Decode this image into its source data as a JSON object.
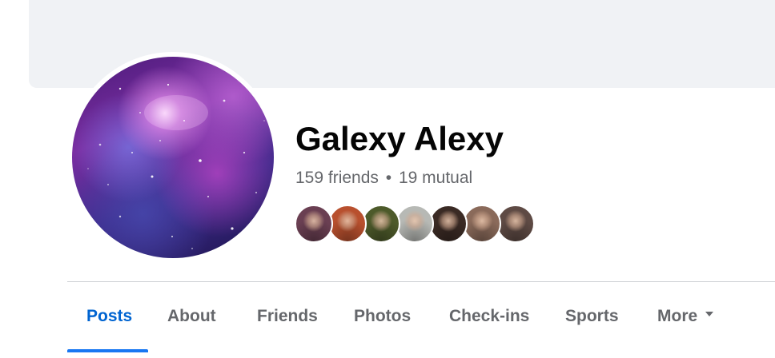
{
  "profile": {
    "name": "Galexy Alexy",
    "friends_count": "159 friends",
    "separator": "•",
    "mutual_count": "19 mutual"
  },
  "friend_avatars": [
    {
      "icon": "friend-avatar-1",
      "color": "#6a3f52"
    },
    {
      "icon": "friend-avatar-2",
      "color": "#b8502e"
    },
    {
      "icon": "friend-avatar-3",
      "color": "#4d5a2a"
    },
    {
      "icon": "friend-avatar-4",
      "color": "#b7b9b5"
    },
    {
      "icon": "friend-avatar-5",
      "color": "#3a2a24"
    },
    {
      "icon": "friend-avatar-6",
      "color": "#8a6a5a"
    },
    {
      "icon": "friend-avatar-7",
      "color": "#5e4a44"
    }
  ],
  "tabs": [
    {
      "label": "Posts",
      "active": true
    },
    {
      "label": "About",
      "active": false
    },
    {
      "label": "Friends",
      "active": false
    },
    {
      "label": "Photos",
      "active": false
    },
    {
      "label": "Check-ins",
      "active": false
    },
    {
      "label": "Sports",
      "active": false
    },
    {
      "label": "More",
      "active": false,
      "icon": "caret-down-icon"
    }
  ],
  "colors": {
    "accent": "#0064d1",
    "underline": "#1877f2",
    "muted_text": "#65676b",
    "cover_bg": "#f0f2f5"
  }
}
